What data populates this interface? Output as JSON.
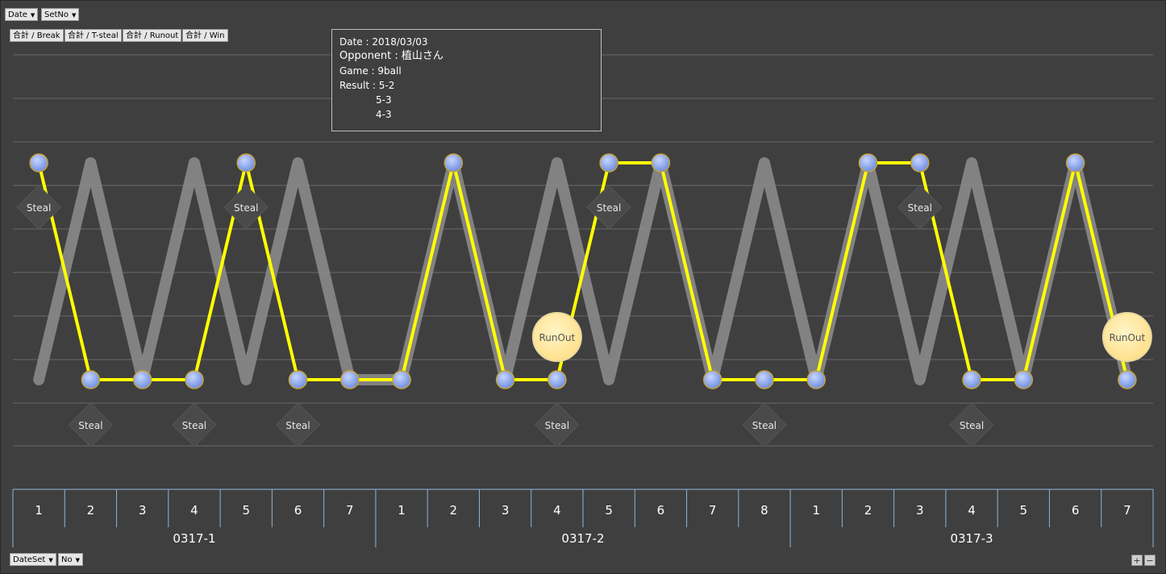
{
  "controls": {
    "filter_date": "Date",
    "filter_setno": "SetNo",
    "axis_dateset": "DateSet",
    "axis_no": "No",
    "zoom_in": "+",
    "zoom_out": "−"
  },
  "legend": [
    "合計 / Break",
    "合計 / T-steal",
    "合計 / Runout",
    "合計 / Win"
  ],
  "tooltip": {
    "date": "Date : 2018/03/03",
    "opponent_label": "Opponent : ",
    "opponent_value": "植山さん",
    "game": "Game : 9ball",
    "result_label": "Result : ",
    "results": [
      "5-2",
      "5-3",
      "4-3"
    ]
  },
  "colors": {
    "background": "#3f3f3f",
    "win_line": "#ffff00",
    "break_line": "#8a8a8a",
    "node": "#6f8fe0",
    "runout": "#ffe08a",
    "steal": "#4a4a4a"
  },
  "chart_data": {
    "type": "line",
    "groups": [
      {
        "label": "0317-1",
        "games": [
          "1",
          "2",
          "3",
          "4",
          "5",
          "6",
          "7"
        ]
      },
      {
        "label": "0317-2",
        "games": [
          "1",
          "2",
          "3",
          "4",
          "5",
          "6",
          "7",
          "8"
        ]
      },
      {
        "label": "0317-3",
        "games": [
          "1",
          "2",
          "3",
          "4",
          "5",
          "6",
          "7"
        ]
      }
    ],
    "series": [
      {
        "name": "合計 / Win",
        "values": [
          1,
          0,
          0,
          0,
          1,
          0,
          0,
          0,
          1,
          0,
          0,
          1,
          1,
          0,
          0,
          0,
          1,
          1,
          0,
          0,
          1,
          0
        ]
      },
      {
        "name": "合計 / Break",
        "values": [
          0,
          1,
          0,
          1,
          0,
          1,
          0,
          0,
          1,
          0,
          1,
          0,
          1,
          0,
          1,
          0,
          1,
          0,
          1,
          0,
          1,
          0
        ]
      }
    ],
    "markers": [
      {
        "index": 0,
        "label": "Steal",
        "side": "top"
      },
      {
        "index": 1,
        "label": "Steal",
        "side": "bottom"
      },
      {
        "index": 3,
        "label": "Steal",
        "side": "bottom"
      },
      {
        "index": 4,
        "label": "Steal",
        "side": "top"
      },
      {
        "index": 5,
        "label": "Steal",
        "side": "bottom"
      },
      {
        "index": 10,
        "label": "RunOut",
        "side": "runout"
      },
      {
        "index": 10,
        "label": "Steal",
        "side": "bottom"
      },
      {
        "index": 11,
        "label": "Steal",
        "side": "top"
      },
      {
        "index": 14,
        "label": "Steal",
        "side": "bottom"
      },
      {
        "index": 17,
        "label": "Steal",
        "side": "top"
      },
      {
        "index": 18,
        "label": "Steal",
        "side": "bottom"
      },
      {
        "index": 21,
        "label": "RunOut",
        "side": "runout"
      }
    ]
  }
}
